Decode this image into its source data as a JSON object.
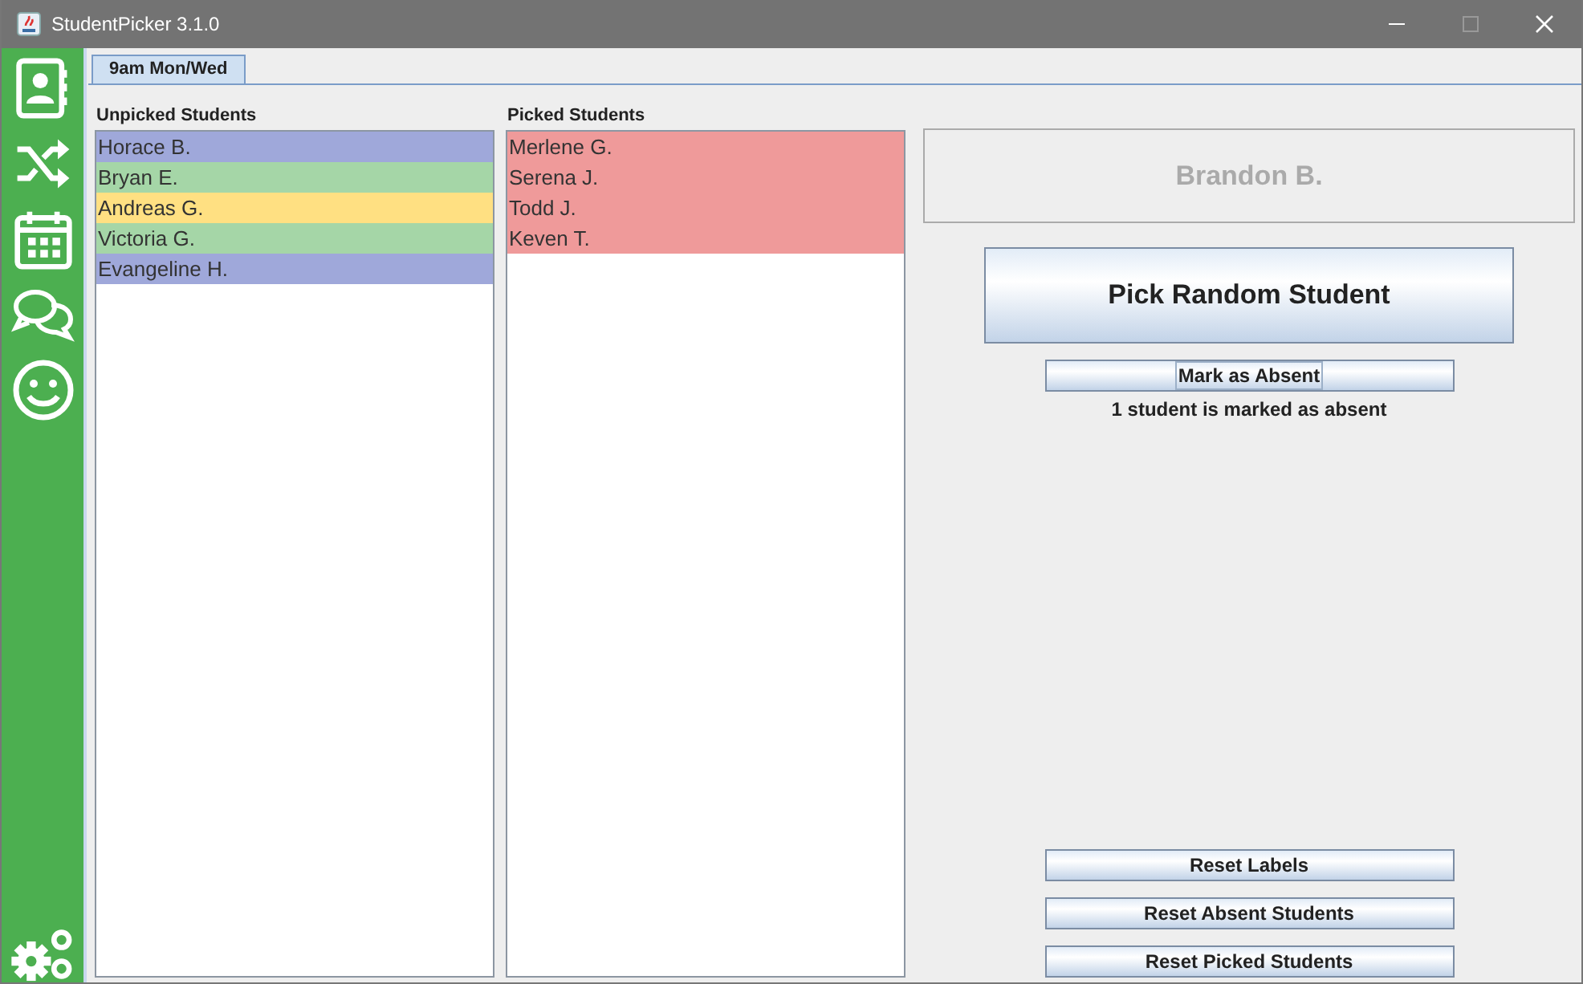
{
  "window": {
    "title": "StudentPicker 3.1.0"
  },
  "tabs": [
    {
      "label": "9am Mon/Wed",
      "selected": true
    }
  ],
  "unpicked": {
    "title": "Unpicked Students",
    "items": [
      {
        "name": "Horace B.",
        "color": "#9fa8da"
      },
      {
        "name": "Bryan E.",
        "color": "#a5d6a7"
      },
      {
        "name": "Andreas G.",
        "color": "#ffe082"
      },
      {
        "name": "Victoria G.",
        "color": "#a5d6a7"
      },
      {
        "name": "Evangeline H.",
        "color": "#9fa8da"
      }
    ]
  },
  "picked": {
    "title": "Picked Students",
    "items": [
      {
        "name": "Merlene G.",
        "color": "#ef9a9a"
      },
      {
        "name": "Serena J.",
        "color": "#ef9a9a"
      },
      {
        "name": "Todd J.",
        "color": "#ef9a9a"
      },
      {
        "name": "Keven T.",
        "color": "#ef9a9a"
      }
    ]
  },
  "current_student": "Brandon B.",
  "pick_button": "Pick Random Student",
  "absent_button": "Mark as Absent",
  "absent_status": "1 student is marked as absent",
  "reset_buttons": [
    "Reset Labels",
    "Reset Absent Students",
    "Reset Picked Students"
  ]
}
